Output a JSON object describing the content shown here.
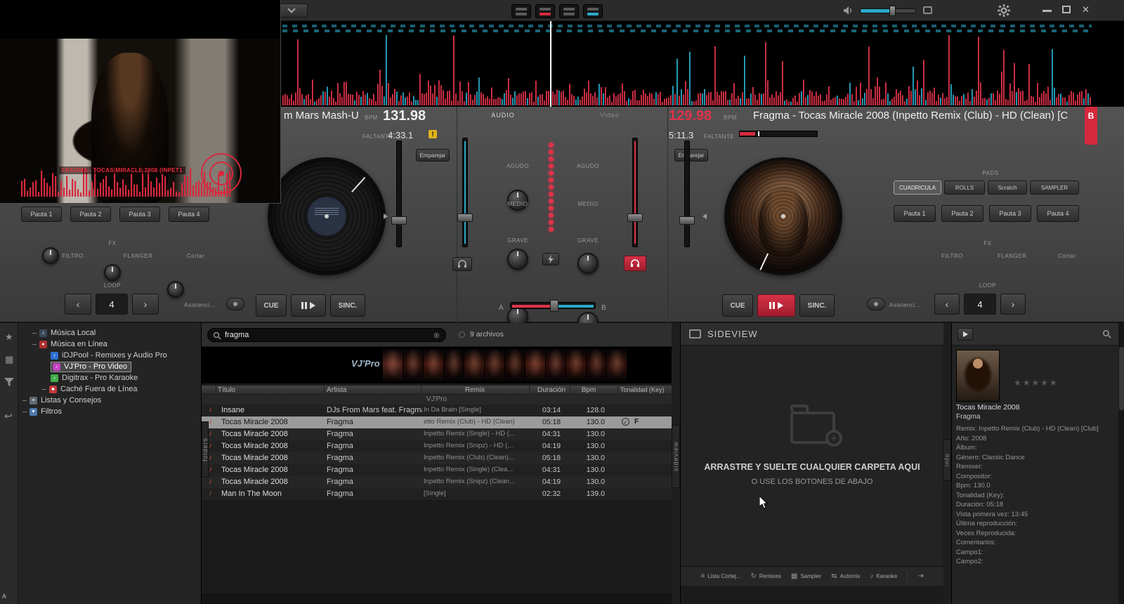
{
  "icons": {
    "close": "✕",
    "clear": "⊗",
    "check": "✓",
    "star": "★",
    "back": "↩",
    "panel": "▦",
    "note": "♪",
    "list": "≡",
    "funnel": "▼",
    "dot": "●",
    "square": "■",
    "arrows": "⇆",
    "repeat": "↻",
    "tab": "⇥",
    "prev": "‹",
    "next": "›",
    "warning": "!"
  },
  "deck_a": {
    "title": "m Mars Mash-U",
    "bpm_label": "BPM",
    "bpm": "131.98",
    "faltante_label": "FALTANTE",
    "remaining": "4:33.1",
    "match_button": "Emparejar",
    "pads": [
      "Pauta 1",
      "Pauta 2",
      "Pauta 3",
      "Pauta 4"
    ],
    "fx_label": "FX",
    "fx_knobs": [
      "FILTRO",
      "FLANGER",
      "Cortar"
    ],
    "loop_label": "LOOP",
    "loop_value": "4",
    "assistant": "Asistenci...",
    "cue_label": "CUE",
    "sync_label": "SINC."
  },
  "deck_b": {
    "title": "Fragma - Tocas Miracle 2008 (Inpetto Remix (Club) - HD  (Clean) [C",
    "bpm_label": "BPM",
    "bpm": "129.98",
    "faltante_label": "FALTANTE",
    "remaining": "5:11.3",
    "deck_tab": "B",
    "match_button": "Emparejar",
    "pads_label": "PADS",
    "pad_modes": [
      "CUADRICULA",
      "ROLLS",
      "Scratch",
      "SAMPLER"
    ],
    "pads": [
      "Pauta 1",
      "Pauta 2",
      "Pauta 3",
      "Pauta 4"
    ],
    "fx_label": "FX",
    "fx_knobs": [
      "FILTRO",
      "FLANGER",
      "Cortar"
    ],
    "loop_label": "LOOP",
    "loop_value": "4",
    "assistant": "Asistenci...",
    "cue_label": "CUE",
    "sync_label": "SINC."
  },
  "mixer": {
    "audio_tab": "AUDIO",
    "video_tab": "Video",
    "eq": [
      "AGUDO",
      "MEDIO",
      "GRAVE"
    ],
    "crossfader_left": "A",
    "crossfader_right": "B"
  },
  "video_overlay": {
    "caption": "FRAGMA - TOCAS MIRACLE 2008 (INPET1"
  },
  "sidebar": {
    "items": [
      {
        "label": "Música Local"
      },
      {
        "label": "Música en Línea"
      },
      {
        "label": "iDJPool - Remixes y Audio Pro"
      },
      {
        "label": "VJ'Pro - Pro Video"
      },
      {
        "label": "Digitrax - Pro Karaoke"
      },
      {
        "label": "Caché Fuera de Línea"
      },
      {
        "label": "Listas y Consejos"
      },
      {
        "label": "Filtros"
      }
    ]
  },
  "browser": {
    "search_value": "fragma",
    "file_count": "9 archivos",
    "brand": "VJ'Pro",
    "group_label": "VJ'Pro",
    "folders_tab": "folders",
    "sideview_tab": "sideview",
    "info_tab": "info",
    "check_glyph": "✓",
    "columns": {
      "title": "Título",
      "artist": "Artista",
      "remix": "Remix",
      "duration": "Duración",
      "bpm": "Bpm",
      "key": "Tonalidad (Key)"
    },
    "rows": [
      {
        "title": "Insane",
        "artist": "DJs From Mars feat. Fragma",
        "remix": "In Da Brain [Single]",
        "duration": "03:14",
        "bpm": "128.0",
        "key": ""
      },
      {
        "title": "Tocas Miracle 2008",
        "artist": "Fragma",
        "remix": "etto Remix (Club) - HD  (Clean)",
        "duration": "05:18",
        "bpm": "130.0",
        "key": "F"
      },
      {
        "title": "Tocas Miracle 2008",
        "artist": "Fragma",
        "remix": "Inpetto Remix (Single) - HD  (...",
        "duration": "04:31",
        "bpm": "130.0",
        "key": ""
      },
      {
        "title": "Tocas Miracle 2008",
        "artist": "Fragma",
        "remix": "Inpetto Remix (Snipz) - HD  (...",
        "duration": "04:19",
        "bpm": "130.0",
        "key": ""
      },
      {
        "title": "Tocas Miracle 2008",
        "artist": "Fragma",
        "remix": "Inpetto Remix (Club)  (Clean)...",
        "duration": "05:18",
        "bpm": "130.0",
        "key": ""
      },
      {
        "title": "Tocas Miracle 2008",
        "artist": "Fragma",
        "remix": "Inpetto Remix (Single)  (Clea...",
        "duration": "04:31",
        "bpm": "130.0",
        "key": ""
      },
      {
        "title": "Tocas Miracle 2008",
        "artist": "Fragma",
        "remix": "Inpetto Remix (Snipz)  (Clean...",
        "duration": "04:19",
        "bpm": "130.0",
        "key": ""
      },
      {
        "title": "Man In The Moon",
        "artist": "Fragma",
        "remix": "[Single]",
        "duration": "02:32",
        "bpm": "139.0",
        "key": ""
      }
    ]
  },
  "sideview": {
    "title": "SIDEVIEW",
    "drop_title": "ARRASTRE Y SUELTE CUALQUIER CARPETA AQUI",
    "drop_subtitle": "O USE LOS BOTONES DE ABAJO",
    "buttons": [
      {
        "label": "Lista Cortej..."
      },
      {
        "label": "Remixes"
      },
      {
        "label": "Sampler"
      },
      {
        "label": "Automix"
      },
      {
        "label": "Karaoke"
      }
    ]
  },
  "info_panel": {
    "title": "Tocas Miracle 2008",
    "artist": "Fragma",
    "rating": "★★★★★",
    "fields": [
      "Remix: Inpetto Remix (Club) - HD  (Clean) [Club]",
      "Año: 2008",
      "Álbum:",
      "Género: Classic Dance",
      "Remixer:",
      "Compositor:",
      "Bpm: 130.0",
      "Tonalidad (Key):",
      "Duración: 05:18",
      "Vista primera vez: 13:45",
      "Última reproducción:",
      "Veces Reproducida:",
      "Comentarios:",
      "Campo1:",
      "Campo2:"
    ]
  },
  "misc": {
    "bottom_corner": "A"
  }
}
